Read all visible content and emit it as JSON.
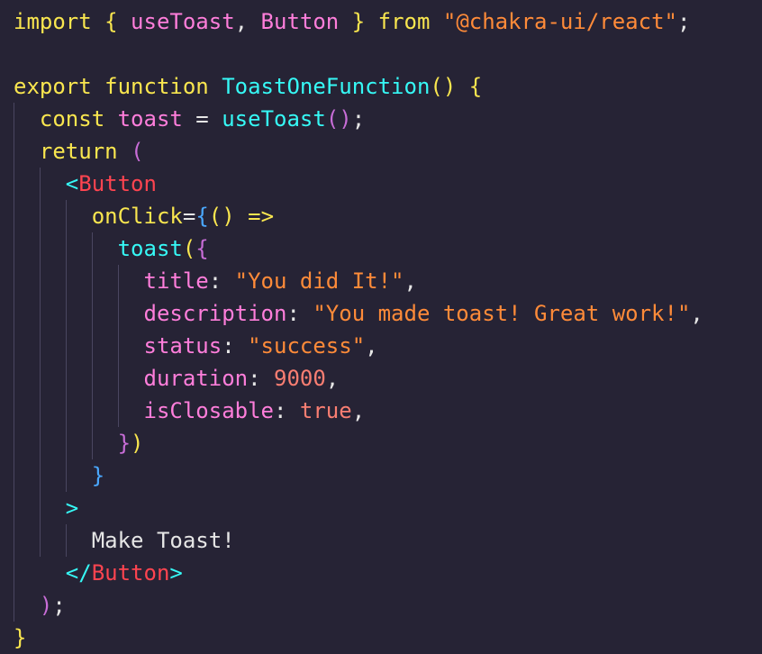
{
  "colors": {
    "background": "#262335",
    "keyword": "#f9e64f",
    "variable": "#ff7edb",
    "function": "#36f9f6",
    "string": "#ff8b39",
    "number": "#f97e72",
    "tag": "#fe4450",
    "punct": "#e6e6e6",
    "bracket_yellow": "#f9e64f",
    "bracket_purple": "#c86dd7",
    "bracket_blue": "#4aa8ff",
    "text": "#e6e6e6",
    "indent_guide": "#4a4660"
  },
  "code": {
    "lines": [
      [
        {
          "t": "import",
          "c": "keyword"
        },
        {
          "t": " ",
          "c": "punct"
        },
        {
          "t": "{",
          "c": "bracket_yellow"
        },
        {
          "t": " useToast",
          "c": "variable"
        },
        {
          "t": ",",
          "c": "punct"
        },
        {
          "t": " Button",
          "c": "variable"
        },
        {
          "t": " ",
          "c": "punct"
        },
        {
          "t": "}",
          "c": "bracket_yellow"
        },
        {
          "t": " from",
          "c": "keyword"
        },
        {
          "t": " ",
          "c": "punct"
        },
        {
          "t": "\"@chakra-ui/react\"",
          "c": "string"
        },
        {
          "t": ";",
          "c": "punct"
        }
      ],
      [],
      [
        {
          "t": "export",
          "c": "keyword"
        },
        {
          "t": " function",
          "c": "keyword"
        },
        {
          "t": " ToastOneFunction",
          "c": "function"
        },
        {
          "t": "()",
          "c": "bracket_yellow"
        },
        {
          "t": " ",
          "c": "punct"
        },
        {
          "t": "{",
          "c": "bracket_yellow"
        }
      ],
      [
        {
          "t": "  ",
          "c": "punct"
        },
        {
          "t": "const",
          "c": "keyword"
        },
        {
          "t": " toast",
          "c": "variable"
        },
        {
          "t": " = ",
          "c": "punct"
        },
        {
          "t": "useToast",
          "c": "function"
        },
        {
          "t": "()",
          "c": "bracket_purple"
        },
        {
          "t": ";",
          "c": "punct"
        }
      ],
      [
        {
          "t": "  ",
          "c": "punct"
        },
        {
          "t": "return",
          "c": "keyword"
        },
        {
          "t": " ",
          "c": "punct"
        },
        {
          "t": "(",
          "c": "bracket_purple"
        }
      ],
      [
        {
          "t": "    ",
          "c": "punct"
        },
        {
          "t": "<",
          "c": "function"
        },
        {
          "t": "Button",
          "c": "tag"
        }
      ],
      [
        {
          "t": "      ",
          "c": "punct"
        },
        {
          "t": "onClick",
          "c": "keyword"
        },
        {
          "t": "=",
          "c": "punct"
        },
        {
          "t": "{",
          "c": "bracket_blue"
        },
        {
          "t": "()",
          "c": "bracket_yellow"
        },
        {
          "t": " =>",
          "c": "keyword"
        }
      ],
      [
        {
          "t": "        ",
          "c": "punct"
        },
        {
          "t": "toast",
          "c": "function"
        },
        {
          "t": "(",
          "c": "bracket_yellow"
        },
        {
          "t": "{",
          "c": "bracket_purple"
        }
      ],
      [
        {
          "t": "          ",
          "c": "punct"
        },
        {
          "t": "title",
          "c": "variable"
        },
        {
          "t": ": ",
          "c": "punct"
        },
        {
          "t": "\"You did It!\"",
          "c": "string"
        },
        {
          "t": ",",
          "c": "punct"
        }
      ],
      [
        {
          "t": "          ",
          "c": "punct"
        },
        {
          "t": "description",
          "c": "variable"
        },
        {
          "t": ": ",
          "c": "punct"
        },
        {
          "t": "\"You made toast! Great work!\"",
          "c": "string"
        },
        {
          "t": ",",
          "c": "punct"
        }
      ],
      [
        {
          "t": "          ",
          "c": "punct"
        },
        {
          "t": "status",
          "c": "variable"
        },
        {
          "t": ": ",
          "c": "punct"
        },
        {
          "t": "\"success\"",
          "c": "string"
        },
        {
          "t": ",",
          "c": "punct"
        }
      ],
      [
        {
          "t": "          ",
          "c": "punct"
        },
        {
          "t": "duration",
          "c": "variable"
        },
        {
          "t": ": ",
          "c": "punct"
        },
        {
          "t": "9000",
          "c": "number"
        },
        {
          "t": ",",
          "c": "punct"
        }
      ],
      [
        {
          "t": "          ",
          "c": "punct"
        },
        {
          "t": "isClosable",
          "c": "variable"
        },
        {
          "t": ": ",
          "c": "punct"
        },
        {
          "t": "true",
          "c": "number"
        },
        {
          "t": ",",
          "c": "punct"
        }
      ],
      [
        {
          "t": "        ",
          "c": "punct"
        },
        {
          "t": "}",
          "c": "bracket_purple"
        },
        {
          "t": ")",
          "c": "bracket_yellow"
        }
      ],
      [
        {
          "t": "      ",
          "c": "punct"
        },
        {
          "t": "}",
          "c": "bracket_blue"
        }
      ],
      [
        {
          "t": "    ",
          "c": "punct"
        },
        {
          "t": ">",
          "c": "function"
        }
      ],
      [
        {
          "t": "      ",
          "c": "punct"
        },
        {
          "t": "Make Toast!",
          "c": "text"
        }
      ],
      [
        {
          "t": "    ",
          "c": "punct"
        },
        {
          "t": "</",
          "c": "function"
        },
        {
          "t": "Button",
          "c": "tag"
        },
        {
          "t": ">",
          "c": "function"
        }
      ],
      [
        {
          "t": "  ",
          "c": "punct"
        },
        {
          "t": ")",
          "c": "bracket_purple"
        },
        {
          "t": ";",
          "c": "punct"
        }
      ],
      [
        {
          "t": "}",
          "c": "bracket_yellow"
        }
      ]
    ]
  }
}
